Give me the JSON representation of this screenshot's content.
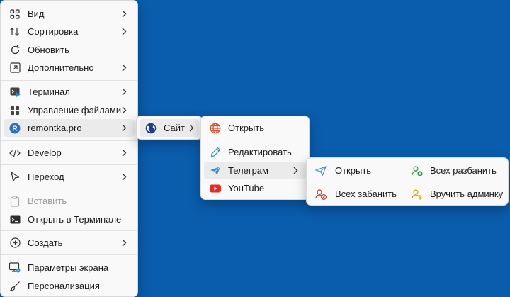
{
  "main_menu": {
    "items": [
      {
        "label": "Вид",
        "icon": "view-grid-icon",
        "submenu": true
      },
      {
        "label": "Сортировка",
        "icon": "sort-icon",
        "submenu": true
      },
      {
        "label": "Обновить",
        "icon": "refresh-icon",
        "submenu": false
      },
      {
        "label": "Дополнительно",
        "icon": "more-options-icon",
        "submenu": true
      },
      {
        "label": "Терминал",
        "icon": "terminal-icon",
        "submenu": true
      },
      {
        "label": "Управление файлами",
        "icon": "file-management-icon",
        "submenu": true
      },
      {
        "label": "remontka.pro",
        "icon": "remontka-logo-icon",
        "submenu": true,
        "highlighted": true
      },
      {
        "label": "Develop",
        "icon": "code-icon",
        "submenu": true
      },
      {
        "label": "Переход",
        "icon": "cursor-icon",
        "submenu": true
      },
      {
        "label": "Вставить",
        "icon": "paste-icon",
        "submenu": false,
        "disabled": true
      },
      {
        "label": "Открыть в Терминале",
        "icon": "open-terminal-icon",
        "submenu": false
      },
      {
        "label": "Создать",
        "icon": "create-plus-icon",
        "submenu": true
      },
      {
        "label": "Параметры экрана",
        "icon": "display-settings-icon",
        "submenu": false
      },
      {
        "label": "Персонализация",
        "icon": "brush-icon",
        "submenu": false
      }
    ]
  },
  "site_menu": {
    "items": [
      {
        "label": "Сайт",
        "icon": "globe-icon",
        "submenu": true,
        "highlighted": true
      }
    ]
  },
  "site_submenu": {
    "items": [
      {
        "label": "Открыть",
        "icon": "open-web-icon",
        "submenu": false
      },
      {
        "label": "Редактировать",
        "icon": "pencil-icon",
        "submenu": false
      },
      {
        "label": "Телеграм",
        "icon": "telegram-icon",
        "submenu": true,
        "highlighted": true
      },
      {
        "label": "YouTube",
        "icon": "youtube-icon",
        "submenu": false
      }
    ]
  },
  "telegram_submenu": {
    "items": [
      {
        "label": "Открыть",
        "icon": "telegram-open-icon"
      },
      {
        "label": "Всех разбанить",
        "icon": "unban-all-icon"
      },
      {
        "label": "Всех забанить",
        "icon": "ban-all-icon"
      },
      {
        "label": "Вручить админку",
        "icon": "grant-admin-icon"
      }
    ]
  },
  "colors": {
    "desktop": "#0a5cac",
    "menu_bg": "#f9f9f9",
    "highlight": "#ebebeb",
    "telegram_blue": "#2f8fd8",
    "youtube_red": "#e52d27"
  }
}
